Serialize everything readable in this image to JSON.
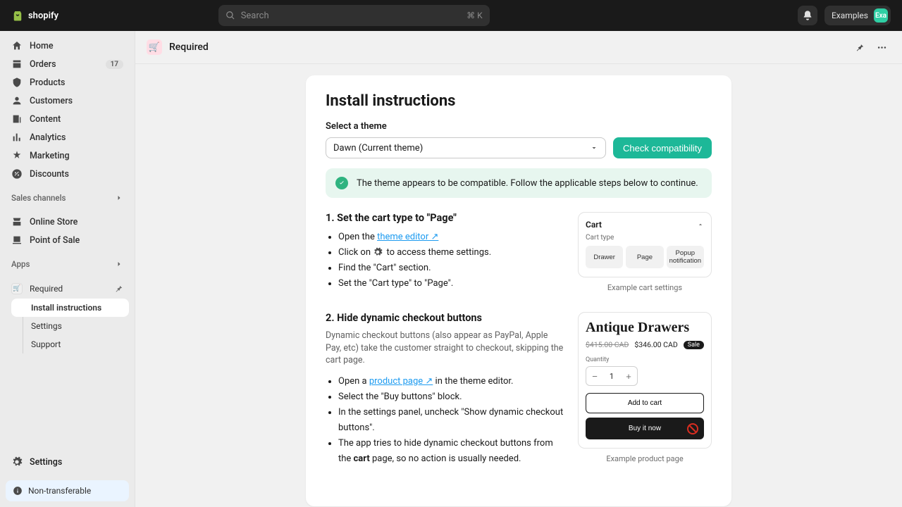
{
  "topbar": {
    "brand": "shopify",
    "search_placeholder": "Search",
    "kbd": "⌘ K",
    "account_name": "Examples",
    "account_initials": "Exa"
  },
  "sidebar": {
    "nav": [
      {
        "label": "Home",
        "icon": "home"
      },
      {
        "label": "Orders",
        "icon": "orders",
        "badge": "17"
      },
      {
        "label": "Products",
        "icon": "products"
      },
      {
        "label": "Customers",
        "icon": "customers"
      },
      {
        "label": "Content",
        "icon": "content"
      },
      {
        "label": "Analytics",
        "icon": "analytics"
      },
      {
        "label": "Marketing",
        "icon": "marketing"
      },
      {
        "label": "Discounts",
        "icon": "discounts"
      }
    ],
    "channels_title": "Sales channels",
    "channels": [
      {
        "label": "Online Store"
      },
      {
        "label": "Point of Sale"
      }
    ],
    "apps_title": "Apps",
    "apps": [
      {
        "label": "Required",
        "sub": [
          {
            "label": "Install instructions",
            "active": true
          },
          {
            "label": "Settings"
          },
          {
            "label": "Support"
          }
        ]
      }
    ],
    "settings_label": "Settings",
    "nontransfer_label": "Non-transferable"
  },
  "page": {
    "app_name": "Required",
    "heading": "Install instructions",
    "select_label": "Select a theme",
    "theme_value": "Dawn (Current theme)",
    "check_btn": "Check compatibility",
    "banner_text": "The theme appears to be compatible. Follow the applicable steps below to continue.",
    "step1": {
      "title": "1. Set the cart type to \"Page\"",
      "b1_pre": "Open the ",
      "b1_link": "theme editor ↗",
      "b2_pre": "Click on ",
      "b2_post": " to access theme settings.",
      "b3": "Find the \"Cart\" section.",
      "b4": "Set the \"Cart type\" to \"Page\".",
      "side": {
        "title": "Cart",
        "opt_label": "Cart type",
        "opts": [
          "Drawer",
          "Page",
          "Popup notification"
        ],
        "caption": "Example cart settings"
      }
    },
    "step2": {
      "title": "2. Hide dynamic checkout buttons",
      "desc": "Dynamic checkout buttons (also appear as PayPal, Apple Pay, etc) take the customer straight to checkout, skipping the cart page.",
      "b1_pre": "Open a ",
      "b1_link": "product page ↗",
      "b1_post": " in the theme editor.",
      "b2": "Select the \"Buy buttons\" block.",
      "b3": "In the settings panel, uncheck \"Show dynamic checkout buttons\".",
      "b4_pre": "The app tries to hide dynamic checkout buttons from the ",
      "b4_bold": "cart",
      "b4_post": " page, so no action is usually needed.",
      "side": {
        "title": "Antique Drawers",
        "price_old": "$415.00 CAD",
        "price_new": "$346.00 CAD",
        "sale": "Sale",
        "qty_label": "Quantity",
        "qty_val": "1",
        "atc": "Add to cart",
        "buy": "Buy it now",
        "caption": "Example product page"
      }
    }
  }
}
